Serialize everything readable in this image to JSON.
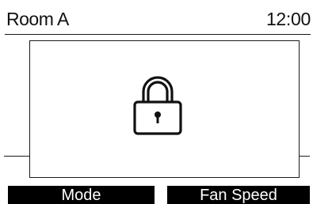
{
  "header": {
    "room_name": "Room A",
    "time": "12:00"
  },
  "lock_dialog": {
    "icon": "lock-icon"
  },
  "softkeys": {
    "left_label": "Mode",
    "right_label": "Fan Speed"
  },
  "colors": {
    "background": "#ffffff",
    "foreground": "#111111",
    "softkey_background": "#000000",
    "softkey_text": "#ffffff"
  }
}
